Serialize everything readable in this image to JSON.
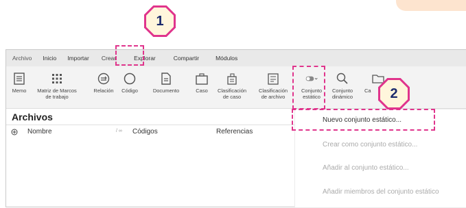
{
  "callouts": [
    "1",
    "2"
  ],
  "menu": [
    "Archivo",
    "Inicio",
    "Importar",
    "Crear",
    "Explorar",
    "Compartir",
    "Módulos"
  ],
  "ribbon": [
    {
      "label": "Memo",
      "icon": "memo-icon"
    },
    {
      "label": "Matriz de Marcos\nde trabajo",
      "icon": "grid-icon"
    },
    {
      "label": "Relación",
      "icon": "relation-icon"
    },
    {
      "label": "Código",
      "icon": "circle-icon"
    },
    {
      "label": "Documento",
      "icon": "document-icon"
    },
    {
      "label": "Caso",
      "icon": "case-icon"
    },
    {
      "label": "Clasificación\nde caso",
      "icon": "case-classification-icon"
    },
    {
      "label": "Clasificación\nde archivo",
      "icon": "file-classification-icon"
    },
    {
      "label": "Conjunto\nestático",
      "icon": "toggle-icon"
    },
    {
      "label": "Conjunto\ndinámico",
      "icon": "magnifier-icon"
    },
    {
      "label": "Ca",
      "icon": "folder-icon"
    }
  ],
  "section_title": "Archivos",
  "columns": {
    "name": "Nombre",
    "codes": "Códigos",
    "refs": "Referencias"
  },
  "dropdown": [
    "Nuevo conjunto estático...",
    "Crear como conjunto estático...",
    "Añadir al conjunto estático...",
    "Añadir miembros del conjunto estático"
  ]
}
